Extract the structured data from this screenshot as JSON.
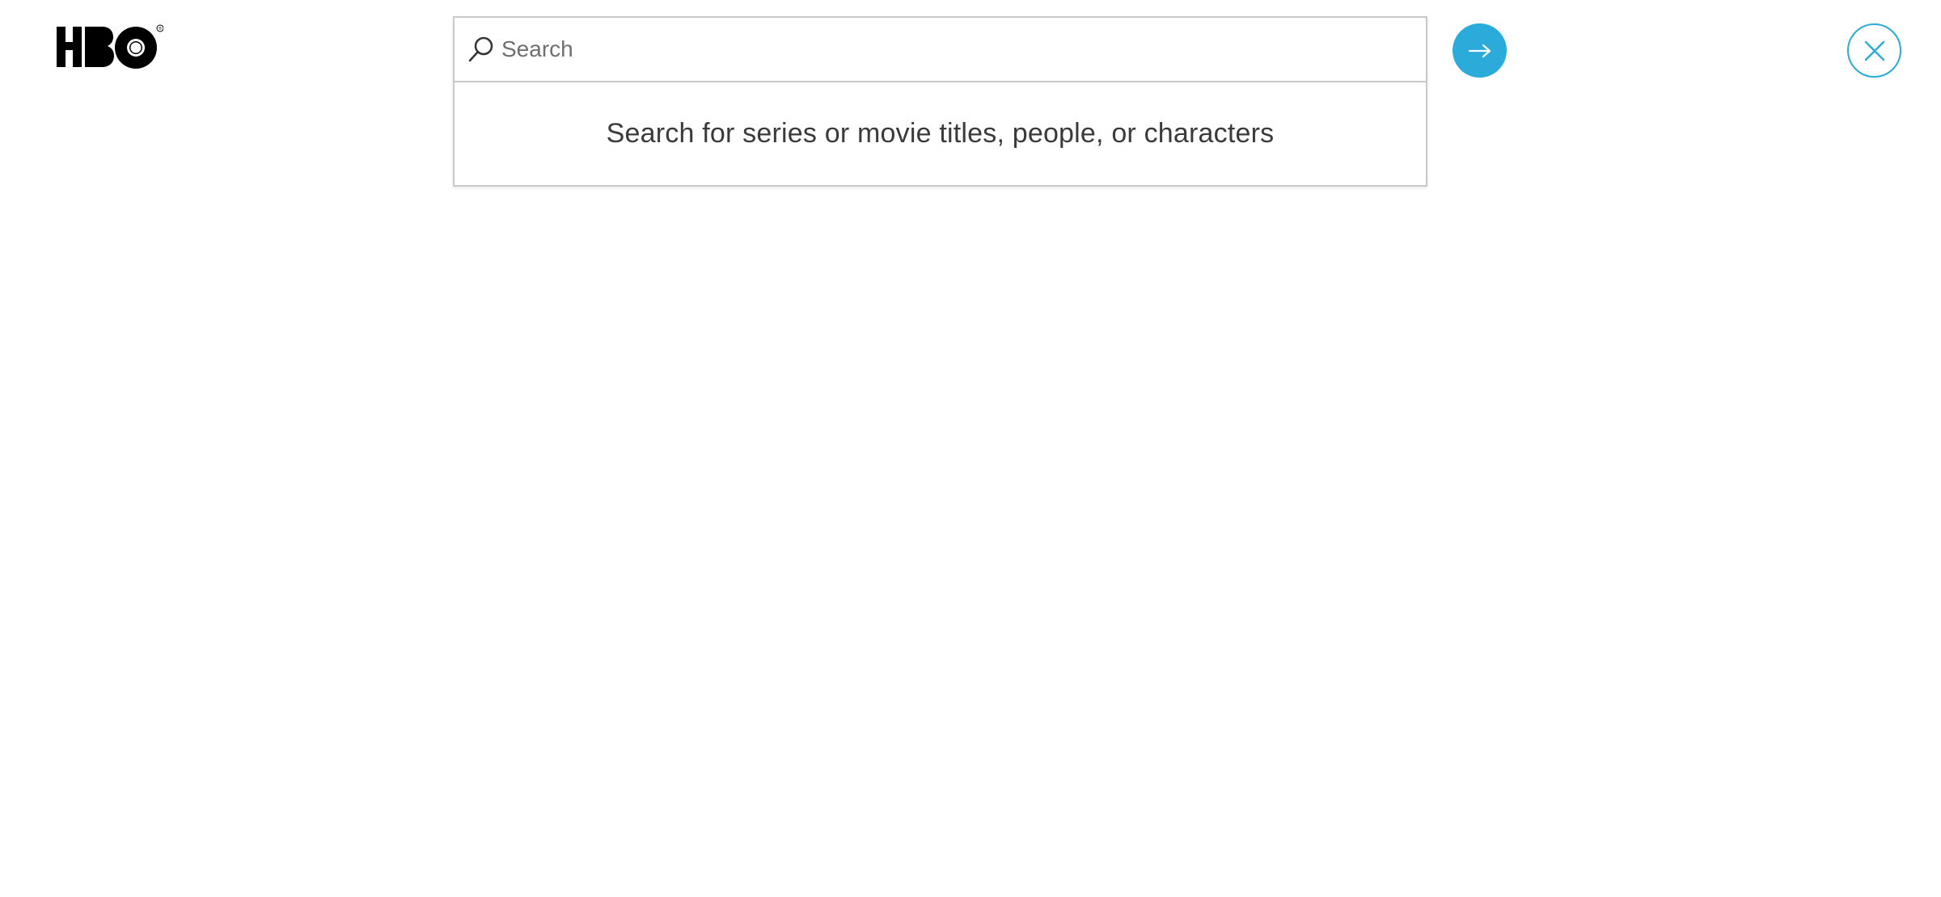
{
  "header": {
    "logo_text": "HBO",
    "logo_trademark": "®"
  },
  "search": {
    "placeholder": "Search",
    "value": "",
    "hint": "Search for series or movie titles, people, or characters"
  },
  "icons": {
    "search": "search-icon",
    "submit": "arrow-right-icon",
    "close": "close-icon"
  },
  "colors": {
    "accent": "#2aabd9",
    "border": "#c9c9c9",
    "text": "#3a3a3a",
    "placeholder": "#6f6f6f",
    "logo": "#000000"
  }
}
